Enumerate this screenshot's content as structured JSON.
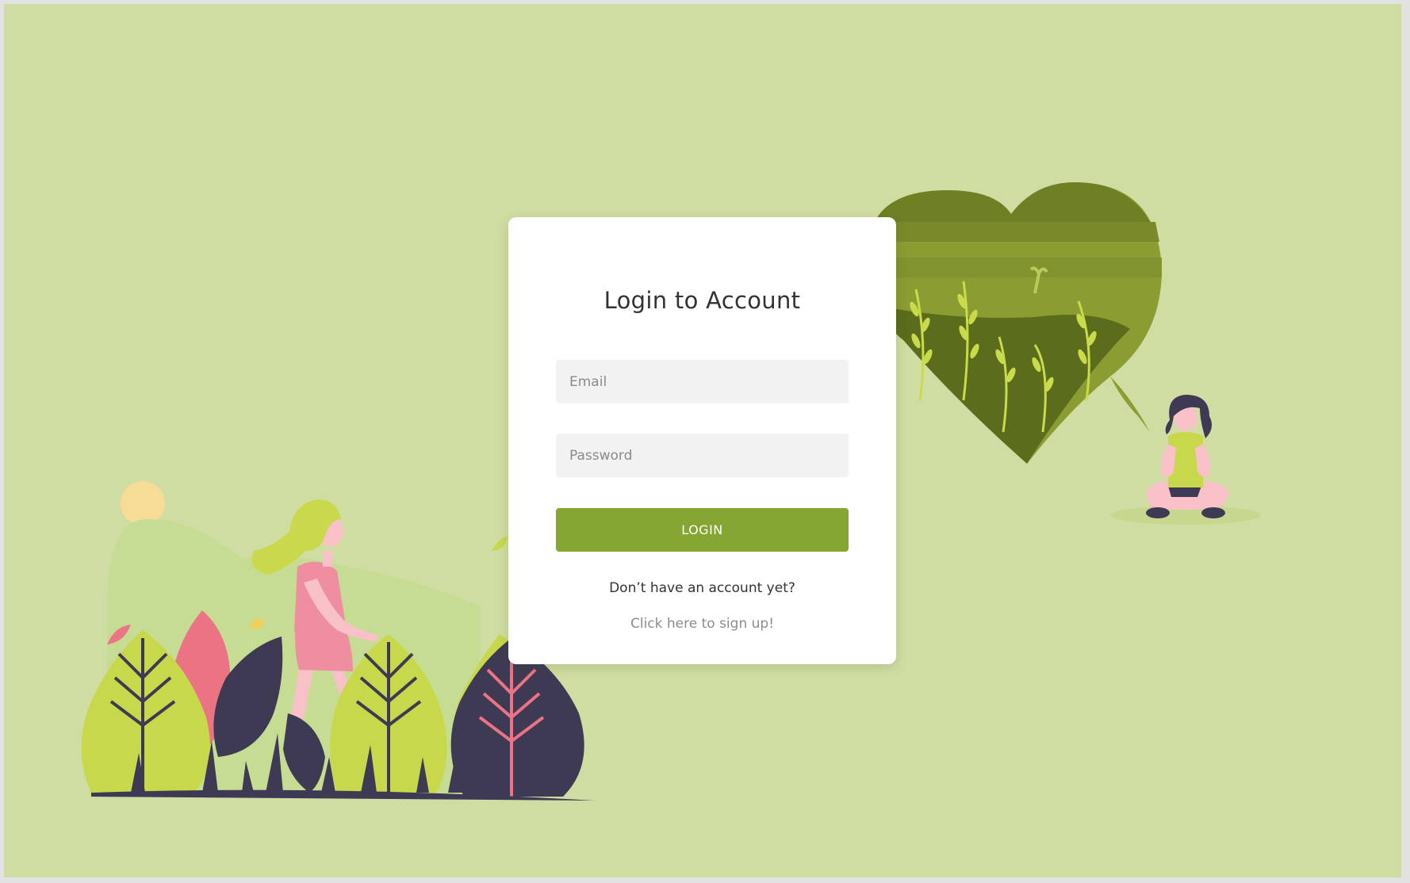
{
  "login_form": {
    "title": "Login to Account",
    "email_placeholder": "Email",
    "password_placeholder": "Password",
    "login_label": "LOGIN",
    "signup_prompt": "Don’t have an account yet?",
    "signup_link": "Click here to sign up!"
  },
  "colors": {
    "background": "#d0dda2",
    "button": "#85a632",
    "card": "#ffffff"
  }
}
